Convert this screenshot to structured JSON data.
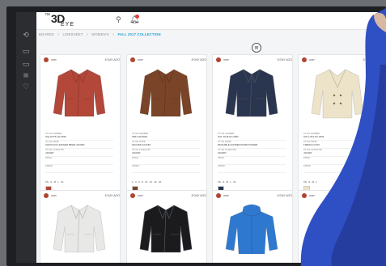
{
  "app": {
    "logo": {
      "prefix": "™",
      "main": "3D",
      "sub": "EYE"
    }
  },
  "breadcrumb": [
    {
      "label": "BOARDS"
    },
    {
      "label": "LINESHEET"
    },
    {
      "label": "WOMEN'S"
    },
    {
      "label": "FALL 2017 COLLECTION",
      "active": true
    }
  ],
  "colors": {
    "accent": "#1a9bd6",
    "rail": "#2b2d31",
    "hand": "#2f4fc4"
  },
  "cards": [
    {
      "user": "user",
      "date": "8 DAY AGO",
      "product": "leather-jacket-red",
      "color": "#b3473a",
      "meta": [
        {
          "label": "STYLE NUMBER",
          "value": "GSL-R7TF-HG-3002"
        },
        {
          "label": "STYLE NAME",
          "value": "SLIM FAUX LEATHER BIKER JACKET"
        },
        {
          "label": "STYLE CATEGORY",
          "value": "JACKET"
        },
        {
          "label": "PRICE",
          "value": ""
        },
        {
          "label": "FABRIC",
          "value": ""
        }
      ],
      "sizes": "XS · S · M · L · XL",
      "likes": "4",
      "comments": "1"
    },
    {
      "user": "user",
      "date": "8 DAY AGO",
      "product": "leather-jacket-brown",
      "color": "#7a4428",
      "meta": [
        {
          "label": "STYLE NUMBER",
          "value": "SDF-G15-5002"
        },
        {
          "label": "STYLE NAME",
          "value": "QUILTED JACKET"
        },
        {
          "label": "STYLE CATEGORY",
          "value": "JACKET"
        },
        {
          "label": "PRICE",
          "value": ""
        },
        {
          "label": "FABRIC",
          "value": ""
        }
      ],
      "sizes": "2 · 4 · 6 · 8 · 10 · 12 · 14 · 16",
      "likes": "",
      "comments": ""
    },
    {
      "user": "user",
      "date": "8 DAY AGO",
      "product": "puffer-jacket-navy",
      "color": "#2a3550",
      "meta": [
        {
          "label": "STYLE NUMBER",
          "value": "GSL-TH15-HG-3002"
        },
        {
          "label": "STYLE NAME",
          "value": "PACKABLE HOODED DOWN PUFFER"
        },
        {
          "label": "STYLE CATEGORY",
          "value": "JACKET"
        },
        {
          "label": "PRICE",
          "value": ""
        },
        {
          "label": "FABRIC",
          "value": ""
        }
      ],
      "sizes": "XS · S · M · L · XL",
      "likes": "4",
      "comments": "1"
    },
    {
      "user": "user",
      "date": "8 DAY AGO",
      "product": "trench-coat-cream",
      "color": "#ece3c8",
      "meta": [
        {
          "label": "STYLE NUMBER",
          "value": "GSL-U7F1-HF-3003"
        },
        {
          "label": "STYLE NAME",
          "value": "TRENCH COAT"
        },
        {
          "label": "STYLE CATEGORY",
          "value": "JACKET"
        },
        {
          "label": "PRICE",
          "value": ""
        },
        {
          "label": "FABRIC",
          "value": ""
        }
      ],
      "sizes": "XS · S · M · L",
      "likes": "",
      "comments": ""
    },
    {
      "user": "user",
      "date": "8 DAY AGO",
      "product": "moto-jacket-white",
      "color": "#e8e8e6"
    },
    {
      "user": "user",
      "date": "8 DAY AGO",
      "product": "moto-jacket-black",
      "color": "#1b1b1d"
    },
    {
      "user": "user",
      "date": "8 DAY AGO",
      "product": "hoodie-blue",
      "color": "#2f78cf"
    },
    {
      "user": "user",
      "date": "8 DAY AGO",
      "product": "hoodie-grey",
      "color": "#9ba5b6"
    }
  ],
  "icons": {
    "rail": [
      "refresh-icon",
      "folder-icon",
      "folder-icon",
      "stack-icon",
      "heart-icon"
    ],
    "header": [
      "pin-icon",
      "bell-icon"
    ],
    "filter": "filter-icon"
  }
}
